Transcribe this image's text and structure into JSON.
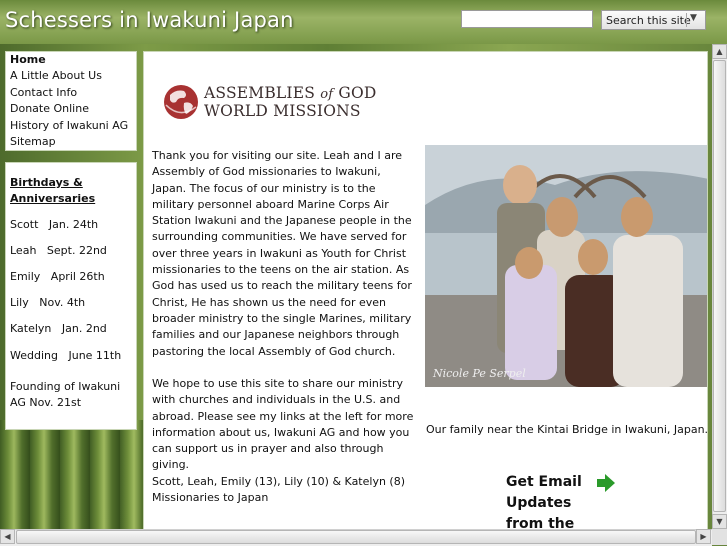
{
  "header": {
    "site_title": "Schessers in Iwakuni Japan",
    "search_value": "",
    "search_button_label": "Search this site",
    "search_button_icon": "chevron-down-icon"
  },
  "nav": {
    "items": [
      {
        "label": "Home",
        "active": true
      },
      {
        "label": "A Little About Us"
      },
      {
        "label": "Contact Info"
      },
      {
        "label": "Donate Online"
      },
      {
        "label": "History of Iwakuni AG"
      },
      {
        "label": "Sitemap"
      }
    ]
  },
  "sidebar": {
    "heading": "Birthdays & Anniversaries",
    "dates": [
      {
        "name": "Scott",
        "date": "Jan. 24th"
      },
      {
        "name": "Leah",
        "date": "Sept. 22nd"
      },
      {
        "name": "Emily",
        "date": "April 26th"
      },
      {
        "name": "Lily",
        "date": "Nov. 4th"
      },
      {
        "name": "Katelyn",
        "date": "Jan. 2nd"
      },
      {
        "name": "Wedding",
        "date": "June 11th"
      }
    ],
    "founding": "Founding of Iwakuni AG   Nov. 21st"
  },
  "main": {
    "logo": {
      "line1_a": "ASSEMBLIES",
      "line1_of": "of",
      "line1_b": "GOD",
      "line2": "WORLD MISSIONS",
      "icon": "globe-icon"
    },
    "paragraph1": "Thank you for visiting our site. Leah and I are Assembly of God missionaries to Iwakuni, Japan. The focus of our ministry is to the military personnel aboard Marine Corps Air Station Iwakuni and the Japanese people in the surrounding communities. We have served for over three years in Iwakuni as Youth for Christ missionaries to the teens on the air station. As God has used us to reach the military teens for Christ, He has shown us the need for even broader ministry to the single Marines, military families and our Japanese neighbors through pastoring the local Assembly of God church.",
    "paragraph2": "We hope to use this site to share our ministry with churches and individuals in the U.S. and abroad. Please see my links at the left for more information about us, Iwakuni AG and how you can support us in prayer and also through giving.",
    "signature_line1": "Scott, Leah, Emily (13), Lily (10) & Katelyn (8)",
    "signature_line2": "Missionaries to Japan",
    "photo_watermark": "Nicole Pe  Serpel",
    "caption": "Our family near the Kintai Bridge in Iwakuni, Japan.",
    "email_cta": "Get Email Updates from the",
    "email_icon": "arrow-right-icon"
  },
  "colors": {
    "accent_green": "#2a9a2a",
    "title_text": "#ffffff"
  }
}
